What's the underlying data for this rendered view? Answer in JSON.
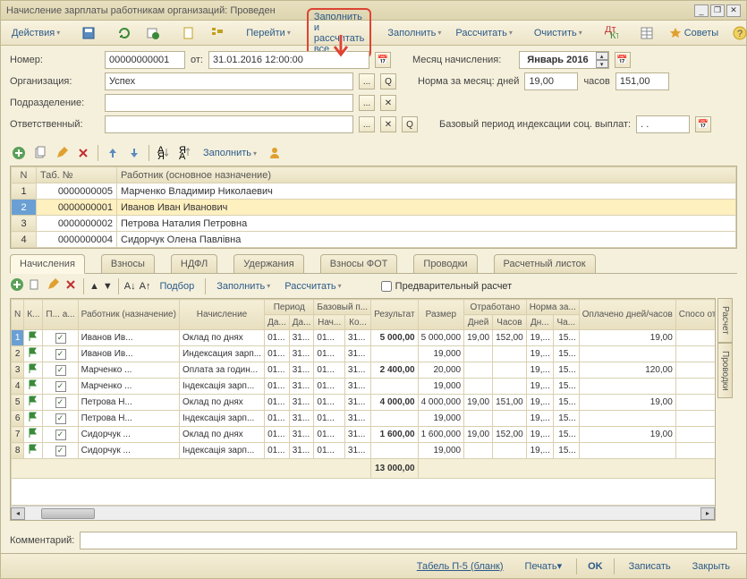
{
  "window": {
    "title": "Начисление зарплаты работникам организаций: Проведен"
  },
  "toolbar": {
    "actions": "Действия",
    "go": "Перейти",
    "fill_calc_all": "Заполнить и рассчитать все",
    "fill": "Заполнить",
    "calc": "Рассчитать",
    "clear": "Очистить",
    "advice": "Советы"
  },
  "form": {
    "number_lbl": "Номер:",
    "number": "00000000001",
    "from_lbl": "от:",
    "date": "31.01.2016 12:00:00",
    "month_lbl": "Месяц начисления:",
    "month": "Январь 2016",
    "org_lbl": "Организация:",
    "org": "Успех",
    "norm_lbl": "Норма за месяц: дней",
    "norm_days": "19,00",
    "hours_lbl": "часов",
    "norm_hours": "151,00",
    "dept_lbl": "Подразделение:",
    "resp_lbl": "Ответственный:",
    "base_period_lbl": "Базовый период индексации соц. выплат:",
    "base_period": ". .",
    "comment_lbl": "Комментарий:"
  },
  "mini_toolbar": {
    "fill": "Заполнить"
  },
  "grid1": {
    "headers": [
      "N",
      "Таб. №",
      "Работник (основное назначение)"
    ],
    "rows": [
      {
        "n": "1",
        "tab": "0000000005",
        "name": "Марченко Владимир Николаевич"
      },
      {
        "n": "2",
        "tab": "0000000001",
        "name": "Иванов Иван Иванович"
      },
      {
        "n": "3",
        "tab": "0000000002",
        "name": "Петрова Наталия Петровна"
      },
      {
        "n": "4",
        "tab": "0000000004",
        "name": "Сидорчук Олена Павлівна"
      }
    ]
  },
  "tabs": [
    "Начисления",
    "Взносы",
    "НДФЛ",
    "Удержания",
    "Взносы ФОТ",
    "Проводки",
    "Расчетный листок"
  ],
  "sub_toolbar": {
    "select": "Подбор",
    "fill": "Заполнить",
    "calc": "Рассчитать",
    "preview": "Предварительный расчет"
  },
  "grid2": {
    "h1": [
      "N",
      "К...",
      "П... а...",
      "Работник (назначение)",
      "Начисление",
      "Период",
      "",
      "Базовый п...",
      "",
      "Результат",
      "Размер",
      "Отработано",
      "",
      "Норма за...",
      "",
      "Оплачено дней/часов",
      "Спосо отраж"
    ],
    "h2": [
      "",
      "",
      "",
      "",
      "",
      "Да...",
      "Да...",
      "Нач...",
      "Ко...",
      "",
      "",
      "Дней",
      "Часов",
      "Дн...",
      "Ча...",
      "",
      ""
    ],
    "rows": [
      {
        "n": "1",
        "emp": "Иванов Ив...",
        "acc": "Оклад по днях",
        "p1": "01...",
        "p2": "31...",
        "b1": "01...",
        "b2": "31...",
        "res": "5 000,00",
        "size": "5 000,000",
        "od": "19,00",
        "oh": "152,00",
        "nd": "19,...",
        "nh": "15...",
        "paid": "19,00"
      },
      {
        "n": "2",
        "emp": "Иванов Ив...",
        "acc": "Индексация зарп...",
        "p1": "01...",
        "p2": "31...",
        "b1": "01...",
        "b2": "31...",
        "res": "",
        "size": "19,000",
        "od": "",
        "oh": "",
        "nd": "19,...",
        "nh": "15...",
        "paid": ""
      },
      {
        "n": "3",
        "emp": "Марченко ...",
        "acc": "Оплата за годин...",
        "p1": "01...",
        "p2": "31...",
        "b1": "01...",
        "b2": "31...",
        "res": "2 400,00",
        "size": "20,000",
        "od": "",
        "oh": "",
        "nd": "19,...",
        "nh": "15...",
        "paid": "120,00"
      },
      {
        "n": "4",
        "emp": "Марченко ...",
        "acc": "Індексація зарп...",
        "p1": "01...",
        "p2": "31...",
        "b1": "01...",
        "b2": "31...",
        "res": "",
        "size": "19,000",
        "od": "",
        "oh": "",
        "nd": "19,...",
        "nh": "15...",
        "paid": ""
      },
      {
        "n": "5",
        "emp": "Петрова Н...",
        "acc": "Оклад по днях",
        "p1": "01...",
        "p2": "31...",
        "b1": "01...",
        "b2": "31...",
        "res": "4 000,00",
        "size": "4 000,000",
        "od": "19,00",
        "oh": "151,00",
        "nd": "19,...",
        "nh": "15...",
        "paid": "19,00"
      },
      {
        "n": "6",
        "emp": "Петрова Н...",
        "acc": "Індексація зарп...",
        "p1": "01...",
        "p2": "31...",
        "b1": "01...",
        "b2": "31...",
        "res": "",
        "size": "19,000",
        "od": "",
        "oh": "",
        "nd": "19,...",
        "nh": "15...",
        "paid": ""
      },
      {
        "n": "7",
        "emp": "Сидорчук ...",
        "acc": "Оклад по днях",
        "p1": "01...",
        "p2": "31...",
        "b1": "01...",
        "b2": "31...",
        "res": "1 600,00",
        "size": "1 600,000",
        "od": "19,00",
        "oh": "152,00",
        "nd": "19,...",
        "nh": "15...",
        "paid": "19,00"
      },
      {
        "n": "8",
        "emp": "Сидорчук ...",
        "acc": "Індексація зарп...",
        "p1": "01...",
        "p2": "31...",
        "b1": "01...",
        "b2": "31...",
        "res": "",
        "size": "19,000",
        "od": "",
        "oh": "",
        "nd": "19,...",
        "nh": "15...",
        "paid": ""
      }
    ],
    "total_res": "13 000,00"
  },
  "side_tabs": [
    "Расчет",
    "Проводки"
  ],
  "footer": {
    "tabel": "Табель П-5 (бланк)",
    "print": "Печать",
    "ok": "OK",
    "save": "Записать",
    "close": "Закрыть"
  }
}
